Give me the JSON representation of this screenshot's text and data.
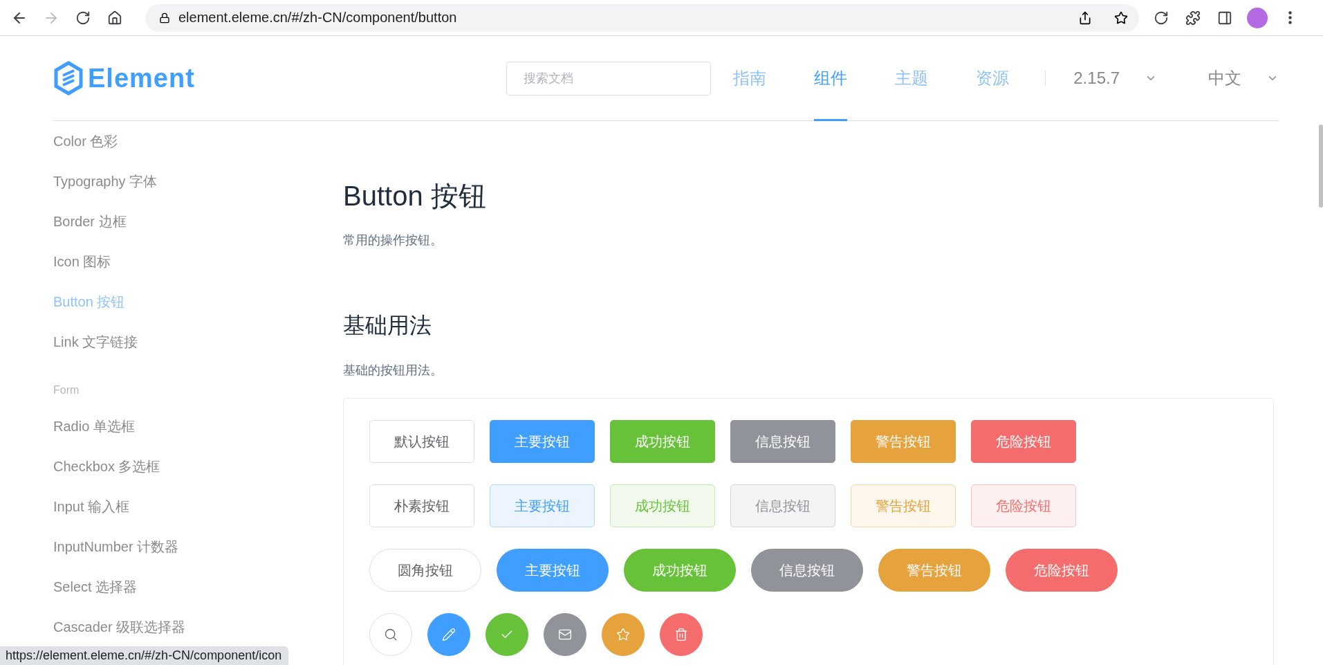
{
  "browser": {
    "url": "element.eleme.cn/#/zh-CN/component/button",
    "forward_disabled": true,
    "status_url": "https://element.eleme.cn/#/zh-CN/component/icon"
  },
  "header": {
    "logo_text": "Element",
    "search": {
      "placeholder": "搜索文档"
    },
    "nav": [
      {
        "label": "指南",
        "selected": false
      },
      {
        "label": "组件",
        "selected": true
      },
      {
        "label": "主题",
        "selected": false
      },
      {
        "label": "资源",
        "selected": false
      }
    ],
    "version": "2.15.7",
    "language": "中文"
  },
  "sidebar": {
    "items": [
      {
        "kind": "item",
        "label": "Color 色彩",
        "selected": false
      },
      {
        "kind": "item",
        "label": "Typography 字体",
        "selected": false
      },
      {
        "kind": "item",
        "label": "Border 边框",
        "selected": false
      },
      {
        "kind": "item",
        "label": "Icon 图标",
        "selected": false
      },
      {
        "kind": "item",
        "label": "Button 按钮",
        "selected": true
      },
      {
        "kind": "item",
        "label": "Link 文字链接",
        "selected": false
      },
      {
        "kind": "group",
        "label": "Form"
      },
      {
        "kind": "item",
        "label": "Radio 单选框",
        "selected": false
      },
      {
        "kind": "item",
        "label": "Checkbox 多选框",
        "selected": false
      },
      {
        "kind": "item",
        "label": "Input 输入框",
        "selected": false
      },
      {
        "kind": "item",
        "label": "InputNumber 计数器",
        "selected": false
      },
      {
        "kind": "item",
        "label": "Select 选择器",
        "selected": false
      },
      {
        "kind": "item",
        "label": "Cascader 级联选择器",
        "selected": false
      }
    ]
  },
  "content": {
    "title": "Button 按钮",
    "description": "常用的操作按钮。",
    "section_title": "基础用法",
    "section_description": "基础的按钮用法。",
    "demo_rows": [
      {
        "kind": "solid",
        "buttons": [
          {
            "kind": "default",
            "label": "默认按钮"
          },
          {
            "kind": "primary",
            "label": "主要按钮"
          },
          {
            "kind": "success",
            "label": "成功按钮"
          },
          {
            "kind": "info",
            "label": "信息按钮"
          },
          {
            "kind": "warning",
            "label": "警告按钮"
          },
          {
            "kind": "danger",
            "label": "危险按钮"
          }
        ]
      },
      {
        "kind": "plain",
        "buttons": [
          {
            "kind": "default",
            "label": "朴素按钮"
          },
          {
            "kind": "primary",
            "label": "主要按钮"
          },
          {
            "kind": "success",
            "label": "成功按钮"
          },
          {
            "kind": "info",
            "label": "信息按钮"
          },
          {
            "kind": "warning",
            "label": "警告按钮"
          },
          {
            "kind": "danger",
            "label": "危险按钮"
          }
        ]
      },
      {
        "kind": "round",
        "buttons": [
          {
            "kind": "default",
            "label": "圆角按钮"
          },
          {
            "kind": "primary",
            "label": "主要按钮"
          },
          {
            "kind": "success",
            "label": "成功按钮"
          },
          {
            "kind": "info",
            "label": "信息按钮"
          },
          {
            "kind": "warning",
            "label": "警告按钮"
          },
          {
            "kind": "danger",
            "label": "危险按钮"
          }
        ]
      },
      {
        "kind": "circle",
        "buttons": [
          {
            "kind": "default"
          },
          {
            "kind": "primary"
          },
          {
            "kind": "success"
          },
          {
            "kind": "info"
          },
          {
            "kind": "warning"
          },
          {
            "kind": "danger"
          }
        ]
      }
    ]
  }
}
